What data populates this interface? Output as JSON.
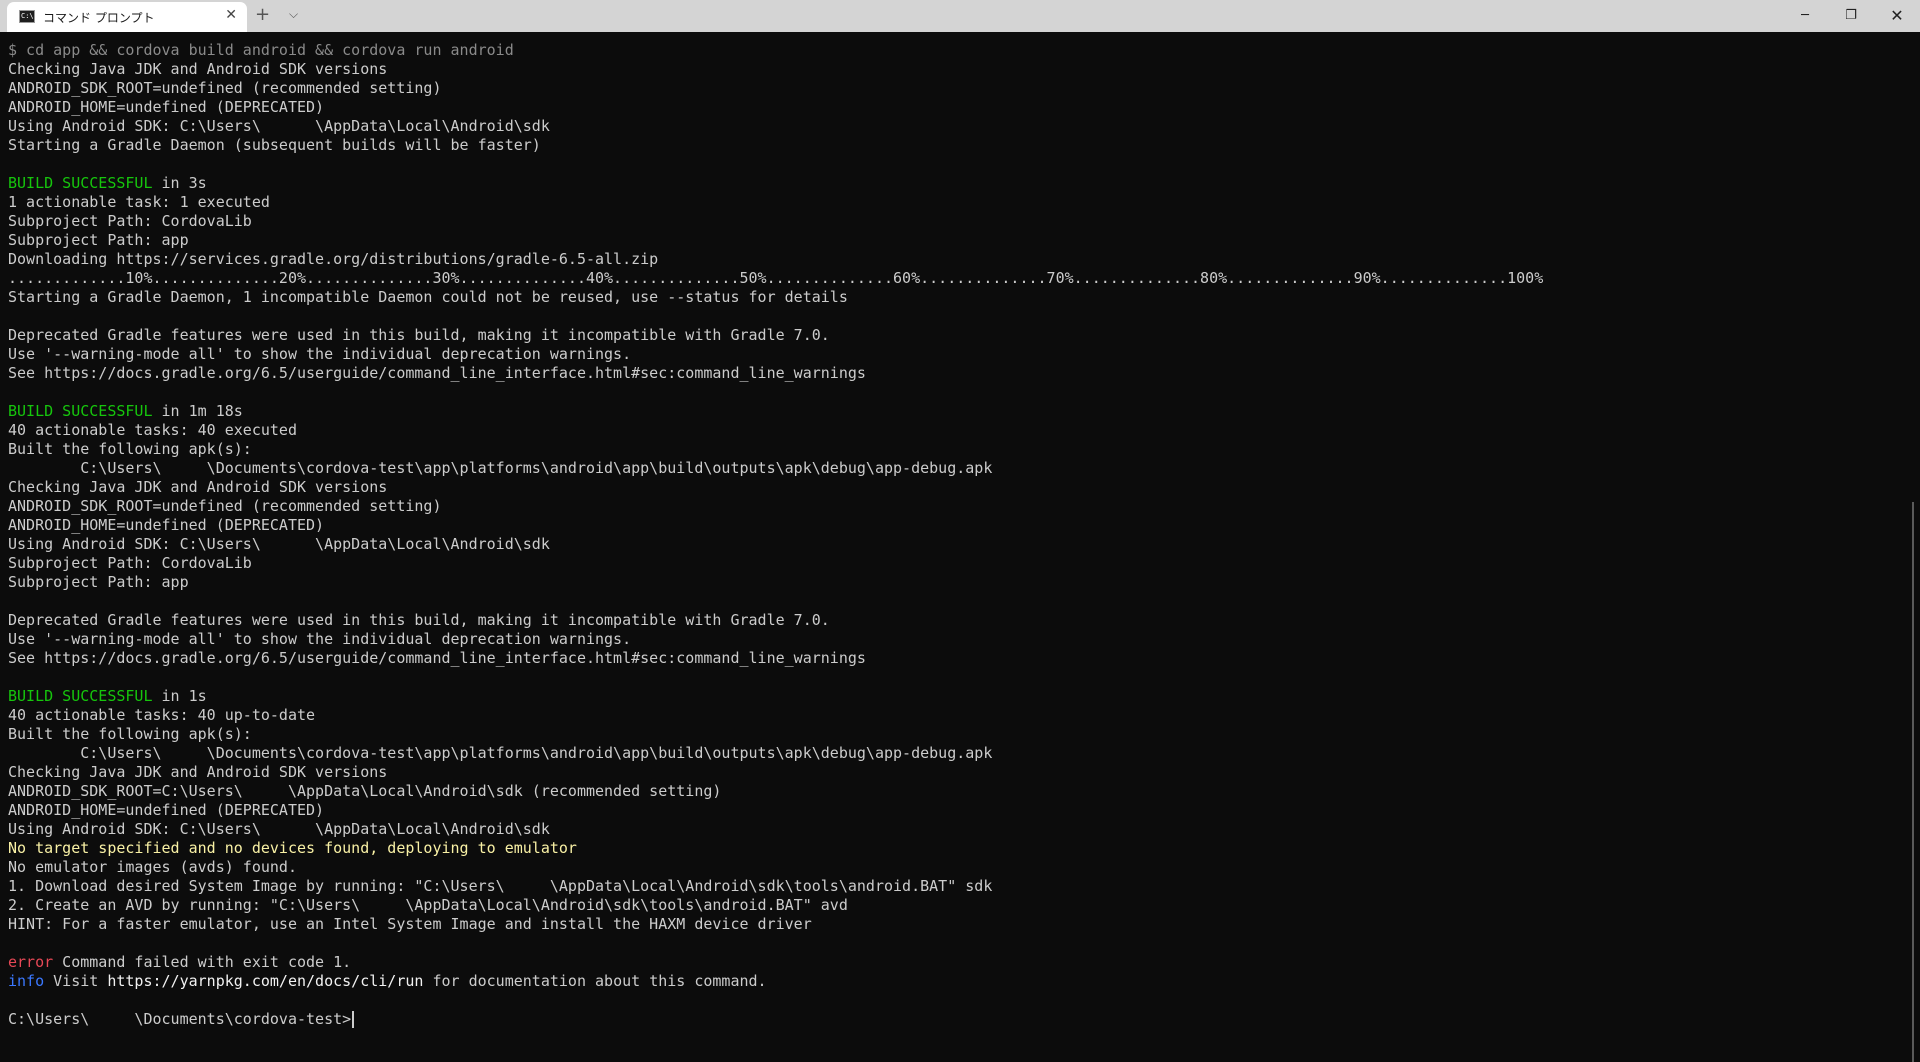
{
  "window": {
    "tab_title": "コマンド プロンプト",
    "tab_icon_text": "C:\\",
    "tab_close_glyph": "✕",
    "new_tab_glyph": "+",
    "dropdown_glyph": "⌵",
    "minimize_glyph": "─",
    "maximize_glyph": "❐",
    "close_glyph": "✕"
  },
  "terminal": {
    "lines": [
      {
        "spans": [
          {
            "text": "$ cd app && cordova build android && cordova run android",
            "style": "cmd"
          }
        ]
      },
      {
        "spans": [
          {
            "text": "Checking Java JDK and Android SDK versions"
          }
        ]
      },
      {
        "spans": [
          {
            "text": "ANDROID_SDK_ROOT=undefined (recommended setting)"
          }
        ]
      },
      {
        "spans": [
          {
            "text": "ANDROID_HOME=undefined (DEPRECATED)"
          }
        ]
      },
      {
        "spans": [
          {
            "text": "Using Android SDK: C:\\Users\\      \\AppData\\Local\\Android\\sdk"
          }
        ]
      },
      {
        "spans": [
          {
            "text": "Starting a Gradle Daemon (subsequent builds will be faster)"
          }
        ]
      },
      {
        "spans": [
          {
            "text": ""
          }
        ]
      },
      {
        "spans": [
          {
            "text": "BUILD SUCCESSFUL",
            "style": "ok"
          },
          {
            "text": " in 3s"
          }
        ]
      },
      {
        "spans": [
          {
            "text": "1 actionable task: 1 executed"
          }
        ]
      },
      {
        "spans": [
          {
            "text": "Subproject Path: CordovaLib"
          }
        ]
      },
      {
        "spans": [
          {
            "text": "Subproject Path: app"
          }
        ]
      },
      {
        "spans": [
          {
            "text": "Downloading https://services.gradle.org/distributions/gradle-6.5-all.zip"
          }
        ]
      },
      {
        "spans": [
          {
            "text": ".............10%..............20%..............30%..............40%..............50%..............60%..............70%..............80%..............90%..............100%"
          }
        ]
      },
      {
        "spans": [
          {
            "text": "Starting a Gradle Daemon, 1 incompatible Daemon could not be reused, use --status for details"
          }
        ]
      },
      {
        "spans": [
          {
            "text": ""
          }
        ]
      },
      {
        "spans": [
          {
            "text": "Deprecated Gradle features were used in this build, making it incompatible with Gradle 7.0."
          }
        ]
      },
      {
        "spans": [
          {
            "text": "Use '--warning-mode all' to show the individual deprecation warnings."
          }
        ]
      },
      {
        "spans": [
          {
            "text": "See https://docs.gradle.org/6.5/userguide/command_line_interface.html#sec:command_line_warnings"
          }
        ]
      },
      {
        "spans": [
          {
            "text": ""
          }
        ]
      },
      {
        "spans": [
          {
            "text": "BUILD SUCCESSFUL",
            "style": "ok"
          },
          {
            "text": " in 1m 18s"
          }
        ]
      },
      {
        "spans": [
          {
            "text": "40 actionable tasks: 40 executed"
          }
        ]
      },
      {
        "spans": [
          {
            "text": "Built the following apk(s):"
          }
        ]
      },
      {
        "spans": [
          {
            "text": "        C:\\Users\\     \\Documents\\cordova-test\\app\\platforms\\android\\app\\build\\outputs\\apk\\debug\\app-debug.apk"
          }
        ]
      },
      {
        "spans": [
          {
            "text": "Checking Java JDK and Android SDK versions"
          }
        ]
      },
      {
        "spans": [
          {
            "text": "ANDROID_SDK_ROOT=undefined (recommended setting)"
          }
        ]
      },
      {
        "spans": [
          {
            "text": "ANDROID_HOME=undefined (DEPRECATED)"
          }
        ]
      },
      {
        "spans": [
          {
            "text": "Using Android SDK: C:\\Users\\      \\AppData\\Local\\Android\\sdk"
          }
        ]
      },
      {
        "spans": [
          {
            "text": "Subproject Path: CordovaLib"
          }
        ]
      },
      {
        "spans": [
          {
            "text": "Subproject Path: app"
          }
        ]
      },
      {
        "spans": [
          {
            "text": ""
          }
        ]
      },
      {
        "spans": [
          {
            "text": "Deprecated Gradle features were used in this build, making it incompatible with Gradle 7.0."
          }
        ]
      },
      {
        "spans": [
          {
            "text": "Use '--warning-mode all' to show the individual deprecation warnings."
          }
        ]
      },
      {
        "spans": [
          {
            "text": "See https://docs.gradle.org/6.5/userguide/command_line_interface.html#sec:command_line_warnings"
          }
        ]
      },
      {
        "spans": [
          {
            "text": ""
          }
        ]
      },
      {
        "spans": [
          {
            "text": "BUILD SUCCESSFUL",
            "style": "ok"
          },
          {
            "text": " in 1s"
          }
        ]
      },
      {
        "spans": [
          {
            "text": "40 actionable tasks: 40 up-to-date"
          }
        ]
      },
      {
        "spans": [
          {
            "text": "Built the following apk(s):"
          }
        ]
      },
      {
        "spans": [
          {
            "text": "        C:\\Users\\     \\Documents\\cordova-test\\app\\platforms\\android\\app\\build\\outputs\\apk\\debug\\app-debug.apk"
          }
        ]
      },
      {
        "spans": [
          {
            "text": "Checking Java JDK and Android SDK versions"
          }
        ]
      },
      {
        "spans": [
          {
            "text": "ANDROID_SDK_ROOT=C:\\Users\\     \\AppData\\Local\\Android\\sdk (recommended setting)"
          }
        ]
      },
      {
        "spans": [
          {
            "text": "ANDROID_HOME=undefined (DEPRECATED)"
          }
        ]
      },
      {
        "spans": [
          {
            "text": "Using Android SDK: C:\\Users\\      \\AppData\\Local\\Android\\sdk"
          }
        ]
      },
      {
        "spans": [
          {
            "text": "No target specified and no devices found, deploying to emulator",
            "style": "warn"
          }
        ]
      },
      {
        "spans": [
          {
            "text": "No emulator images (avds) found."
          }
        ]
      },
      {
        "spans": [
          {
            "text": "1. Download desired System Image by running: \"C:\\Users\\     \\AppData\\Local\\Android\\sdk\\tools\\android.BAT\" sdk"
          }
        ]
      },
      {
        "spans": [
          {
            "text": "2. Create an AVD by running: \"C:\\Users\\     \\AppData\\Local\\Android\\sdk\\tools\\android.BAT\" avd"
          }
        ]
      },
      {
        "spans": [
          {
            "text": "HINT: For a faster emulator, use an Intel System Image and install the HAXM device driver"
          }
        ]
      },
      {
        "spans": [
          {
            "text": ""
          }
        ]
      },
      {
        "spans": [
          {
            "text": "error",
            "style": "err"
          },
          {
            "text": " Command failed with exit code 1."
          }
        ]
      },
      {
        "spans": [
          {
            "text": "info",
            "style": "info"
          },
          {
            "text": " Visit "
          },
          {
            "text": "https://yarnpkg.com/en/docs/cli/run",
            "style": "bold"
          },
          {
            "text": " for documentation about this command."
          }
        ]
      },
      {
        "spans": [
          {
            "text": ""
          }
        ]
      },
      {
        "spans": [
          {
            "text": "C:\\Users\\     \\Documents\\cordova-test>"
          }
        ],
        "cursor": true
      }
    ]
  }
}
